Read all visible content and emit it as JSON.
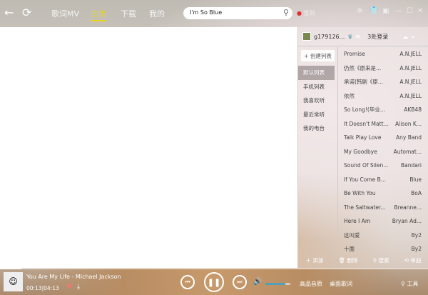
{
  "header": {
    "tabs": [
      "歌词MV",
      "曲库",
      "下载",
      "我的"
    ],
    "active_tab": "曲库",
    "search_value": "I'm So Blue",
    "checkin": "签到"
  },
  "user": {
    "name": "g179126...",
    "login_status": "3处登录"
  },
  "playlists": {
    "create_label": "+ 创建列表",
    "items": [
      "默认列表",
      "手机列表",
      "我喜欢听",
      "最近常听",
      "我的电台"
    ]
  },
  "songs": [
    {
      "title": "Promise",
      "artist": "A.N.JELL"
    },
    {
      "title": "仍然《原来是...",
      "artist": "A.N.JELL"
    },
    {
      "title": "承诺(韩剧《原...",
      "artist": "A.N.JELL"
    },
    {
      "title": "依然",
      "artist": "A.N.JELL"
    },
    {
      "title": "So Long!(毕业...",
      "artist": "AKB48"
    },
    {
      "title": "It Doesn't Matt...",
      "artist": "Alison K..."
    },
    {
      "title": "Talk Play Love",
      "artist": "Any Band"
    },
    {
      "title": "My Goodbye",
      "artist": "Automat..."
    },
    {
      "title": "Sound Of Silen...",
      "artist": "Bandari"
    },
    {
      "title": "If You Come B...",
      "artist": "Blue"
    },
    {
      "title": "Be With You",
      "artist": "BoA"
    },
    {
      "title": "The Saltwater...",
      "artist": "Breanne..."
    },
    {
      "title": "Here I Am",
      "artist": "Bryan Ad..."
    },
    {
      "title": "这叫爱",
      "artist": "By2"
    },
    {
      "title": "十面",
      "artist": "By2"
    }
  ],
  "panel_actions": [
    "添加",
    "删除",
    "搜索",
    "单曲"
  ],
  "player": {
    "now_playing": "You Are My Life - Michael Jackson",
    "time": "00:13|04:13",
    "progress": 0.05,
    "volume": 0.8,
    "quality": "高品音质",
    "desktop_lyrics": "桌面歌词",
    "tools": "工具"
  }
}
